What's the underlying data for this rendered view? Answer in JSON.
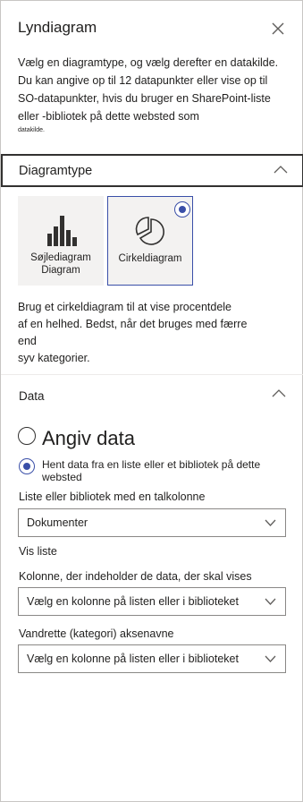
{
  "panel": {
    "title": "Lyndiagram",
    "description": "Vælg en diagramtype, og vælg derefter en datakilde. Du kan angive op til 12 datapunkter eller vise op til SO-datapunkter, hvis du bruger en SharePoint-liste eller -bibliotek på dette websted som",
    "description_small": "datakilde."
  },
  "chart_type_section": {
    "label": "Diagramtype",
    "options": [
      {
        "label_line1": "Søjlediagram",
        "label_line2": "Diagram",
        "selected": false
      },
      {
        "label_line1": "Cirkeldiagram",
        "label_line2": "",
        "selected": true
      }
    ],
    "help_line1": "Brug et cirkeldiagram til at vise procentdele",
    "help_line2": "af en helhed. Bedst, når det bruges med færre end",
    "help_line3": "syv kategorier."
  },
  "data_section": {
    "label": "Data",
    "radio_manual": "Angiv data",
    "radio_list": "Hent data fra en liste eller et bibliotek på dette websted",
    "list_label": "Liste eller bibliotek med en talkolonne",
    "list_value": "Dokumenter",
    "view_label": "Vis liste",
    "column_label": "Kolonne, der indeholder de data, der skal vises",
    "column_value": "Vælg en kolonne på listen eller i biblioteket",
    "axis_label": "Vandrette (kategori) aksenavne",
    "axis_value": "Vælg en kolonne på listen eller i biblioteket"
  },
  "colors": {
    "accent": "#3a4fa8",
    "border": "#323130",
    "card_bg": "#f3f2f1"
  }
}
